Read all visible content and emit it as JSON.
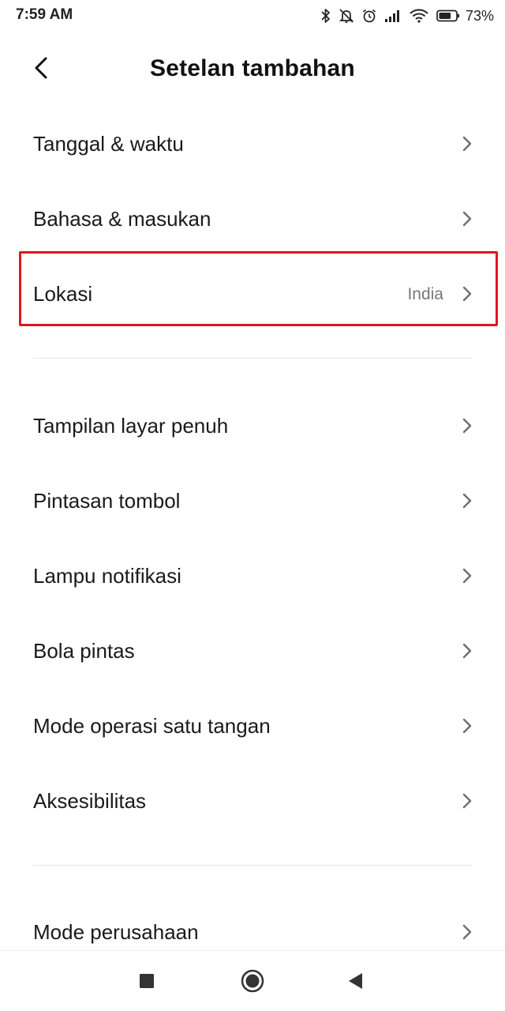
{
  "status_bar": {
    "time": "7:59 AM",
    "battery_percent": "73%",
    "battery_level": 0.73,
    "icons": [
      "bluetooth-icon",
      "silent-bell-icon",
      "alarm-icon",
      "signal-icon",
      "wifi-icon",
      "battery-icon"
    ]
  },
  "header": {
    "title": "Setelan tambahan",
    "back_icon": "back-arrow-icon"
  },
  "settings": {
    "items": [
      {
        "label": "Tanggal & waktu",
        "value": ""
      },
      {
        "label": "Bahasa & masukan",
        "value": ""
      },
      {
        "label": "Lokasi",
        "value": "India"
      },
      {
        "label": "Tampilan layar penuh",
        "value": ""
      },
      {
        "label": "Pintasan tombol",
        "value": ""
      },
      {
        "label": "Lampu notifikasi",
        "value": ""
      },
      {
        "label": "Bola pintas",
        "value": ""
      },
      {
        "label": "Mode operasi satu tangan",
        "value": ""
      },
      {
        "label": "Aksesibilitas",
        "value": ""
      },
      {
        "label": "Mode perusahaan",
        "value": ""
      }
    ],
    "highlighted_item": "Lokasi",
    "highlight_color": "#e3141e"
  },
  "nav_bar": {
    "buttons": [
      "recents-square-icon",
      "home-circle-icon",
      "back-triangle-icon"
    ]
  }
}
